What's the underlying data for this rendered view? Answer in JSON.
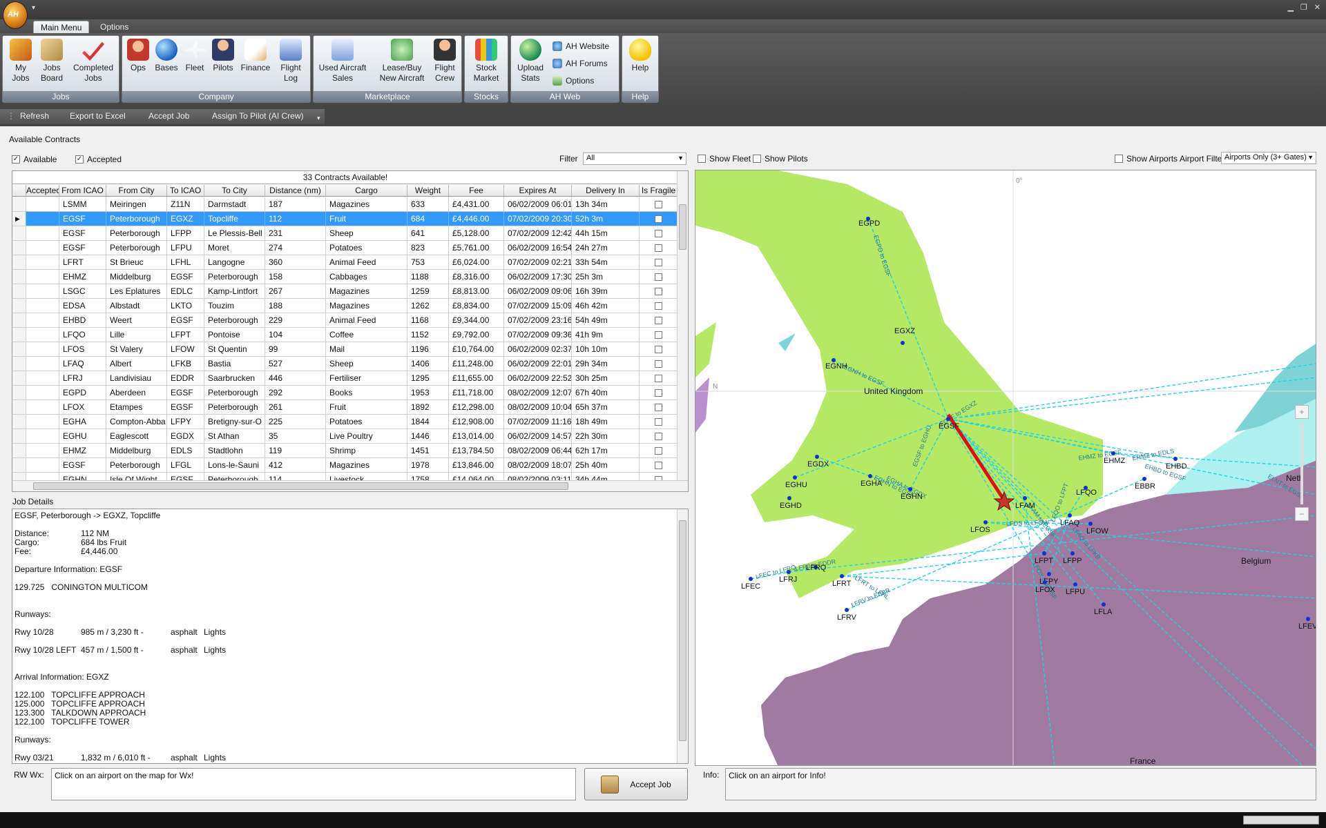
{
  "app": {
    "logo_text": "AH",
    "menu_tabs": [
      "Main Menu",
      "Options"
    ]
  },
  "ribbon": {
    "groups": [
      {
        "label": "Jobs",
        "buttons": [
          "My\nJobs",
          "Jobs\nBoard",
          "Completed\nJobs"
        ]
      },
      {
        "label": "Company",
        "buttons": [
          "Ops",
          "Bases",
          "Fleet",
          "Pilots",
          "Finance",
          "Flight\nLog"
        ]
      },
      {
        "label": "Marketplace",
        "buttons": [
          "Used Aircraft\nSales",
          "Lease/Buy\nNew Aircraft",
          "Flight\nCrew"
        ]
      },
      {
        "label": "Stocks",
        "buttons": [
          "Stock\nMarket"
        ]
      },
      {
        "label": "AH Web",
        "buttons": [
          "Upload\nStats"
        ],
        "small_buttons": [
          "AH Website",
          "AH Forums",
          "Options"
        ]
      },
      {
        "label": "Help",
        "buttons": [
          "Help"
        ]
      }
    ]
  },
  "toolbar": [
    "Refresh",
    "Export to Excel",
    "Accept Job",
    "Assign To Pilot (AI Crew)"
  ],
  "contracts": {
    "section_title": "Available Contracts",
    "available_label": "Available",
    "accepted_label": "Accepted",
    "filter_label": "Filter",
    "filter_value": "All",
    "grid_title": "33 Contracts Available!",
    "columns": [
      "Accepted",
      "From ICAO",
      "From City",
      "To ICAO",
      "To City",
      "Distance (nm)",
      "Cargo",
      "Weight",
      "Fee",
      "Expires At",
      "Delivery In",
      "Is Fragile"
    ],
    "rows": [
      [
        "",
        "LSMM",
        "Meiringen",
        "Z11N",
        "Darmstadt",
        "187",
        "Magazines",
        "633",
        "£4,431.00",
        "06/02/2009 06:01",
        "13h 34m",
        ""
      ],
      [
        "",
        "EGSF",
        "Peterborough",
        "EGXZ",
        "Topcliffe",
        "112",
        "Fruit",
        "684",
        "£4,446.00",
        "07/02/2009 20:30",
        "52h 3m",
        ""
      ],
      [
        "",
        "EGSF",
        "Peterborough",
        "LFPP",
        "Le Plessis-Bell",
        "231",
        "Sheep",
        "641",
        "£5,128.00",
        "07/02/2009 12:42",
        "44h 15m",
        ""
      ],
      [
        "",
        "EGSF",
        "Peterborough",
        "LFPU",
        "Moret",
        "274",
        "Potatoes",
        "823",
        "£5,761.00",
        "06/02/2009 16:54",
        "24h 27m",
        ""
      ],
      [
        "",
        "LFRT",
        "St Brieuc",
        "LFHL",
        "Langogne",
        "360",
        "Animal Feed",
        "753",
        "£6,024.00",
        "07/02/2009 02:21",
        "33h 54m",
        ""
      ],
      [
        "",
        "EHMZ",
        "Middelburg",
        "EGSF",
        "Peterborough",
        "158",
        "Cabbages",
        "1188",
        "£8,316.00",
        "06/02/2009 17:30",
        "25h 3m",
        ""
      ],
      [
        "",
        "LSGC",
        "Les Eplatures",
        "EDLC",
        "Kamp-Lintfort",
        "267",
        "Magazines",
        "1259",
        "£8,813.00",
        "06/02/2009 09:06",
        "16h 39m",
        ""
      ],
      [
        "",
        "EDSA",
        "Albstadt",
        "LKTO",
        "Touzim",
        "188",
        "Magazines",
        "1262",
        "£8,834.00",
        "07/02/2009 15:09",
        "46h 42m",
        ""
      ],
      [
        "",
        "EHBD",
        "Weert",
        "EGSF",
        "Peterborough",
        "229",
        "Animal Feed",
        "1168",
        "£9,344.00",
        "07/02/2009 23:16",
        "54h 49m",
        ""
      ],
      [
        "",
        "LFQO",
        "Lille",
        "LFPT",
        "Pontoise",
        "104",
        "Coffee",
        "1152",
        "£9,792.00",
        "07/02/2009 09:36",
        "41h 9m",
        ""
      ],
      [
        "",
        "LFOS",
        "St Valery",
        "LFOW",
        "St Quentin",
        "99",
        "Mail",
        "1196",
        "£10,764.00",
        "06/02/2009 02:37",
        "10h 10m",
        ""
      ],
      [
        "",
        "LFAQ",
        "Albert",
        "LFKB",
        "Bastia",
        "527",
        "Sheep",
        "1406",
        "£11,248.00",
        "06/02/2009 22:01",
        "29h 34m",
        ""
      ],
      [
        "",
        "LFRJ",
        "Landivisiau",
        "EDDR",
        "Saarbrucken",
        "446",
        "Fertiliser",
        "1295",
        "£11,655.00",
        "06/02/2009 22:52",
        "30h 25m",
        ""
      ],
      [
        "",
        "EGPD",
        "Aberdeen",
        "EGSF",
        "Peterborough",
        "292",
        "Books",
        "1953",
        "£11,718.00",
        "08/02/2009 12:07",
        "67h 40m",
        ""
      ],
      [
        "",
        "LFOX",
        "Etampes",
        "EGSF",
        "Peterborough",
        "261",
        "Fruit",
        "1892",
        "£12,298.00",
        "08/02/2009 10:04",
        "65h 37m",
        ""
      ],
      [
        "",
        "EGHA",
        "Compton-Abba",
        "LFPY",
        "Bretigny-sur-O",
        "225",
        "Potatoes",
        "1844",
        "£12,908.00",
        "07/02/2009 11:16",
        "18h 49m",
        ""
      ],
      [
        "",
        "EGHU",
        "Eaglescott",
        "EGDX",
        "St Athan",
        "35",
        "Live Poultry",
        "1446",
        "£13,014.00",
        "06/02/2009 14:57",
        "22h 30m",
        ""
      ],
      [
        "",
        "EHMZ",
        "Middelburg",
        "EDLS",
        "Stadtlohn",
        "119",
        "Shrimp",
        "1451",
        "£13,784.50",
        "08/02/2009 06:44",
        "62h 17m",
        ""
      ],
      [
        "",
        "EGSF",
        "Peterborough",
        "LFGL",
        "Lons-le-Sauni",
        "412",
        "Magazines",
        "1978",
        "£13,846.00",
        "08/02/2009 18:07",
        "25h 40m",
        ""
      ],
      [
        "",
        "EGHN",
        "Isle Of Wight",
        "EGSF",
        "Peterborough",
        "114",
        "Livestock",
        "1758",
        "£14,064.00",
        "08/02/2009 03:11",
        "34h 44m",
        ""
      ]
    ]
  },
  "job_details": {
    "section_title": "Job Details",
    "headline": "EGSF, Peterborough -> EGXZ, Topcliffe",
    "distance_label": "Distance:",
    "distance": "112 NM",
    "cargo_label": "Cargo:",
    "cargo": "684 lbs Fruit",
    "fee_label": "Fee:",
    "fee": "£4,446.00",
    "departure_title": "Departure Information: EGSF",
    "departure_freq": "129.725   CONINGTON MULTICOM",
    "runways_label": "Runways:",
    "dep_runways": [
      {
        "name": "Rwy 10/28",
        "size": "985 m / 3,230 ft -",
        "surface": "asphalt",
        "lights": "Lights"
      },
      {
        "name": "Rwy 10/28 LEFT",
        "size": "457 m / 1,500 ft -",
        "surface": "asphalt",
        "lights": "Lights"
      }
    ],
    "arrival_title": "Arrival Information: EGXZ",
    "arrival_freqs": [
      "122.100   TOPCLIFFE APPROACH",
      "125.000   TOPCLIFFE APPROACH",
      "123.300   TALKDOWN APPROACH",
      "122.100   TOPCLIFFE TOWER"
    ],
    "arr_runways": [
      {
        "name": "Rwy 03/21",
        "size": "1,832 m / 6,010 ft -",
        "surface": "asphalt",
        "lights": "Lights"
      }
    ]
  },
  "weather": {
    "label": "RW Wx:",
    "text": "Click on an airport on the map for Wx!"
  },
  "accept_button": "Accept Job",
  "info": {
    "label": "Info:",
    "text": "Click on an airport for Info!"
  },
  "map": {
    "show_fleet": "Show Fleet",
    "show_pilots": "Show Pilots",
    "show_airports": "Show Airports",
    "airport_filter_label": "Airport Filter",
    "airport_filter_value": "Airports Only (3+ Gates)",
    "labels": {
      "meridian": "0°",
      "uk": "United Kingdom",
      "france": "France",
      "belgium": "Belgium",
      "neth": "Neth",
      "lat": "N"
    },
    "airports": [
      "EGPD",
      "EGXZ",
      "EGNH",
      "EGSF",
      "EGDX",
      "EGHU",
      "EGHD",
      "EGHA",
      "EGHN",
      "EHMZ",
      "EHBD",
      "EBBR",
      "LFQO",
      "LFAM",
      "LFOS",
      "LFAQ",
      "LFOW",
      "LFPT",
      "LFPP",
      "LFPY",
      "LFOX",
      "LFPU",
      "LFLA",
      "LFEC",
      "LFRJ",
      "LFRQ",
      "LFRT",
      "LFRV",
      "LFEV"
    ],
    "route_labels": [
      "EGPD to EGSF",
      "EGNH to EGSF",
      "EGSF to EGXZ",
      "EGSF to EGHU",
      "EGHN to EGSF",
      "EGHA to EGDX",
      "EHMZ to EGSF",
      "EHMZ to EDLS",
      "EHBD to EGSF",
      "ELNT to EGSF",
      "LFAM to EGSF",
      "LFOS to LFOW",
      "LFQO to LFPT",
      "LFAQ to LFKB",
      "LFOX to EGSF",
      "LFEC to LFRQ",
      "LFRJ to EDDR",
      "LFRT to LFHL",
      "LFRV to EBBR"
    ],
    "colors": {
      "land": "#b5e865",
      "france": "#a07aa0",
      "sea": "#ffffff",
      "route": "#1fd3e3",
      "active_route": "#e01010",
      "neth": "#7fd3d6"
    }
  }
}
